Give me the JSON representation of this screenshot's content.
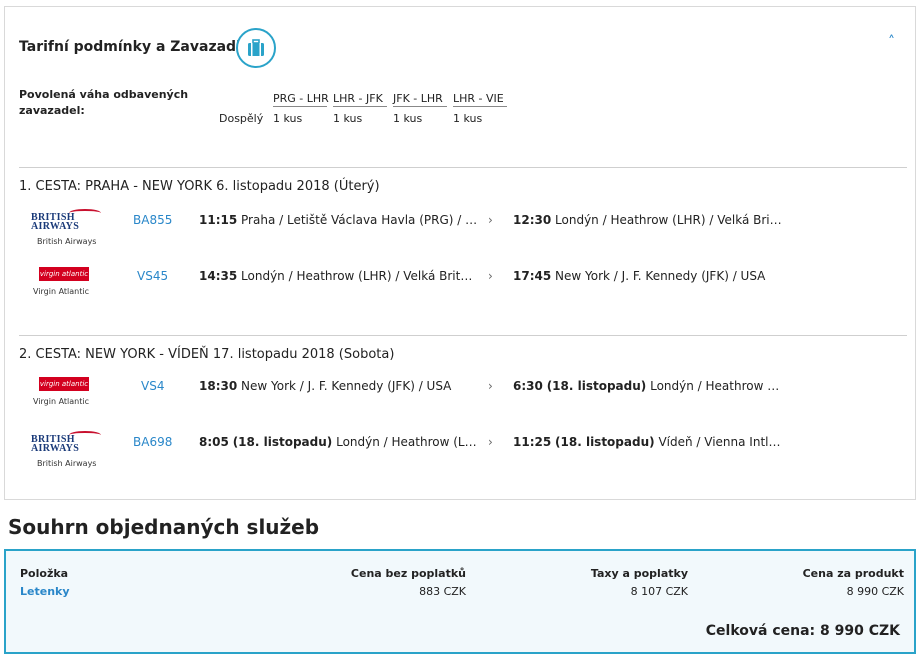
{
  "header": {
    "title": "Tarifní podmínky a Zavazadla",
    "collapse_glyph": "˄",
    "icons": {
      "baggage": "suitcase-icon",
      "collapse": "chevron-up-icon"
    },
    "colors": {
      "accent": "#2aa3c9",
      "link": "#2a87c9"
    }
  },
  "baggage": {
    "label": "Povolená váha odbavených zavazadel:",
    "passenger_type": "Dospělý",
    "legs": [
      {
        "route": "PRG - LHR",
        "allowance": "1 kus"
      },
      {
        "route": "LHR - JFK",
        "allowance": "1 kus"
      },
      {
        "route": "JFK - LHR",
        "allowance": "1 kus"
      },
      {
        "route": "LHR - VIE",
        "allowance": "1 kus"
      }
    ]
  },
  "trips": [
    {
      "title": "1. CESTA: PRAHA - NEW YORK 6. listopadu 2018 (Úterý)",
      "segments": [
        {
          "airline": {
            "logo": "british-airways-logo",
            "wordmark": "BRITISH AIRWAYS",
            "caption": "British Airways"
          },
          "flight_no": "BA855",
          "dep_time": "11:15",
          "dep_place": "Praha / Letiště Václava Havla (PRG) / Čes…",
          "arr_time": "12:30",
          "arr_place": "Londýn / Heathrow (LHR) / Velká Británie"
        },
        {
          "airline": {
            "logo": "virgin-atlantic-logo",
            "wordmark": "virgin atlantic",
            "caption": "Virgin Atlantic"
          },
          "flight_no": "VS45",
          "dep_time": "14:35",
          "dep_place": "Londýn / Heathrow (LHR) / Velká Británie",
          "arr_time": "17:45",
          "arr_place": "New York / J. F. Kennedy (JFK) / USA"
        }
      ]
    },
    {
      "title": "2. CESTA: NEW YORK - VÍDEŇ 17. listopadu 2018 (Sobota)",
      "segments": [
        {
          "airline": {
            "logo": "virgin-atlantic-logo",
            "wordmark": "virgin atlantic",
            "caption": "Virgin Atlantic"
          },
          "flight_no": "VS4",
          "dep_time": "18:30",
          "dep_place": "New York / J. F. Kennedy (JFK) / USA",
          "arr_time": "6:30",
          "arr_date": "(18. listopadu)",
          "arr_place": "Londýn / Heathrow (LHR) …"
        },
        {
          "airline": {
            "logo": "british-airways-logo",
            "wordmark": "BRITISH AIRWAYS",
            "caption": "British Airways"
          },
          "flight_no": "BA698",
          "dep_time": "8:05",
          "dep_date": "(18. listopadu)",
          "dep_place": "Londýn / Heathrow (LHR) …",
          "arr_time": "11:25",
          "arr_date": "(18. listopadu)",
          "arr_place": "Vídeň / Vienna Intl. (VIE) …"
        }
      ]
    }
  ],
  "summary": {
    "title": "Souhrn objednaných služeb",
    "columns": {
      "item": "Položka",
      "base": "Cena bez poplatků",
      "tax": "Taxy a poplatky",
      "product": "Cena za produkt"
    },
    "row": {
      "item": "Letenky",
      "base": "883 CZK",
      "tax": "8 107 CZK",
      "product": "8 990 CZK"
    },
    "total": "Celková cena: 8 990 CZK"
  }
}
